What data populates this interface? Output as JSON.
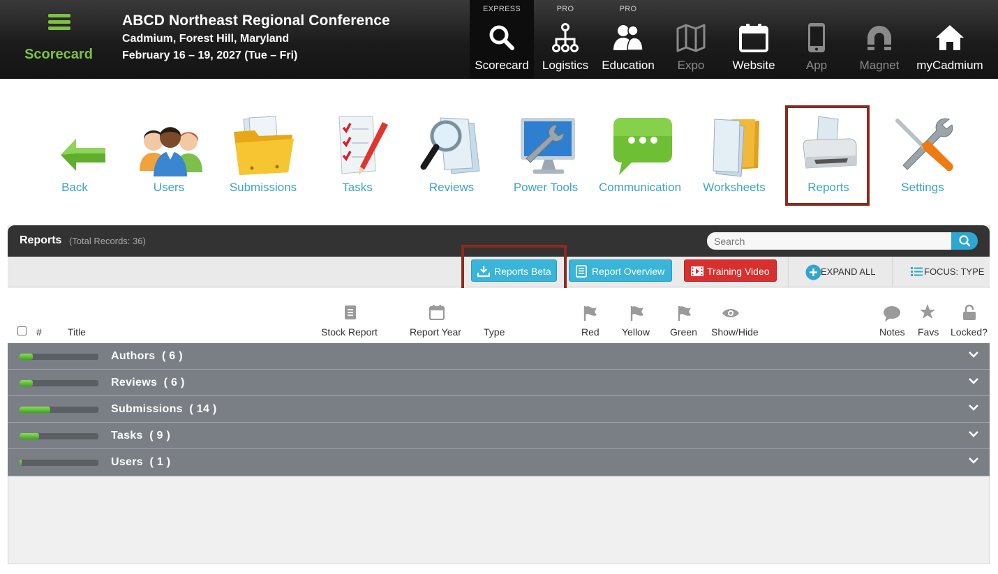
{
  "brand": {
    "label": "Scorecard",
    "menu_icon": "hamburger-icon"
  },
  "event": {
    "title": "ABCD Northeast Regional Conference",
    "location": "Cadmium, Forest Hill, Maryland",
    "dates": "February 16 – 19, 2027 (Tue – Fri)"
  },
  "topnav": [
    {
      "label": "Scorecard",
      "badge": "EXPRESS",
      "icon": "search-icon",
      "active": true
    },
    {
      "label": "Logistics",
      "badge": "PRO",
      "icon": "network-icon"
    },
    {
      "label": "Education",
      "badge": "PRO",
      "icon": "users-icon"
    },
    {
      "label": "Expo",
      "icon": "map-icon",
      "dim": true
    },
    {
      "label": "Website",
      "icon": "calendar-icon"
    },
    {
      "label": "App",
      "icon": "phone-icon",
      "dim": true
    },
    {
      "label": "Magnet",
      "icon": "magnet-icon",
      "dim": true
    },
    {
      "label": "myCadmium",
      "icon": "home-icon"
    }
  ],
  "modules": [
    {
      "label": "Back",
      "icon": "back-arrow-icon"
    },
    {
      "label": "Users",
      "icon": "people-icon"
    },
    {
      "label": "Submissions",
      "icon": "folder-icon"
    },
    {
      "label": "Tasks",
      "icon": "checklist-icon"
    },
    {
      "label": "Reviews",
      "icon": "magnifier-docs-icon"
    },
    {
      "label": "Power Tools",
      "icon": "monitor-wrench-icon"
    },
    {
      "label": "Communication",
      "icon": "chat-bubble-icon"
    },
    {
      "label": "Worksheets",
      "icon": "documents-icon"
    },
    {
      "label": "Reports",
      "icon": "printer-icon",
      "selected": true
    },
    {
      "label": "Settings",
      "icon": "tools-icon"
    }
  ],
  "panel": {
    "title": "Reports",
    "count": "(Total Records: 36)",
    "search_placeholder": "Search"
  },
  "toolbar": {
    "reports_beta": "Reports Beta",
    "report_overview": "Report Overview",
    "training_video": "Training Video",
    "expand_all": "EXPAND ALL",
    "focus_type": "FOCUS: TYPE"
  },
  "columns": {
    "num": "#",
    "title": "Title",
    "stock_report": "Stock Report",
    "report_year": "Report Year",
    "type": "Type",
    "red": "Red",
    "yellow": "Yellow",
    "green": "Green",
    "show_hide": "Show/Hide",
    "notes": "Notes",
    "favs": "Favs",
    "locked": "Locked?"
  },
  "groups": [
    {
      "name": "Authors",
      "count": "( 6 )",
      "progress": 0.17
    },
    {
      "name": "Reviews",
      "count": "( 6 )",
      "progress": 0.17
    },
    {
      "name": "Submissions",
      "count": "( 14 )",
      "progress": 0.39
    },
    {
      "name": "Tasks",
      "count": "( 9 )",
      "progress": 0.25
    },
    {
      "name": "Users",
      "count": "( 1 )",
      "progress": 0.03
    }
  ],
  "colors": {
    "accent": "#3ba4c9",
    "brand_green": "#7dc242",
    "highlight": "#8b2a1e",
    "training_red": "#d8302f"
  }
}
